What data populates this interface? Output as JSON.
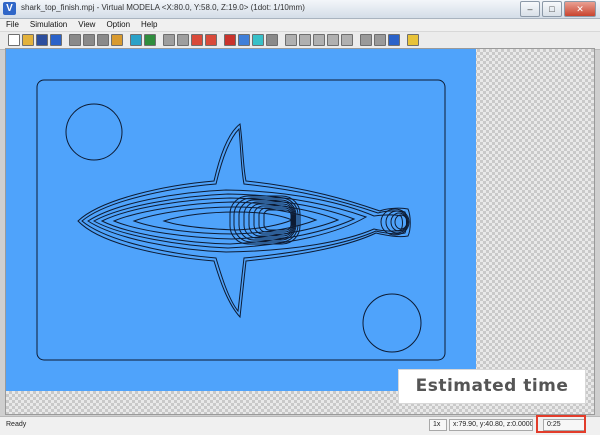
{
  "window": {
    "title": "shark_top_finish.mpj - Virtual MODELA <X:80.0, Y:58.0, Z:19.0> (1dot: 1/10mm)",
    "app_icon_letter": "V",
    "minimize": "–",
    "maximize": "□",
    "close": "✕"
  },
  "menu": {
    "items": [
      "File",
      "Simulation",
      "View",
      "Option",
      "Help"
    ]
  },
  "toolbar": {
    "buttons": [
      {
        "name": "new-file-icon",
        "color": "#ffffff"
      },
      {
        "name": "open-folder-icon",
        "color": "#e3b23c"
      },
      {
        "name": "save-icon",
        "color": "#2d4f9e"
      },
      {
        "name": "restart-icon",
        "color": "#2a62c9"
      },
      {
        "name": "stop-icon",
        "color": "#8a8a8a"
      },
      {
        "name": "play-icon",
        "color": "#8a8a8a"
      },
      {
        "name": "step-icon",
        "color": "#8a8a8a"
      },
      {
        "name": "preview-icon",
        "color": "#d89a2f"
      },
      {
        "name": "view-top-icon",
        "color": "#2aa1c8"
      },
      {
        "name": "view-front-icon",
        "color": "#2f8d3e"
      },
      {
        "name": "tool-path-icon",
        "color": "#9e9e9e"
      },
      {
        "name": "line-icon",
        "color": "#9e9e9e"
      },
      {
        "name": "curve-icon",
        "color": "#d94a3a"
      },
      {
        "name": "3d-view-icon",
        "color": "#d94a3a"
      },
      {
        "name": "red-block-icon",
        "color": "#c9332c"
      },
      {
        "name": "color-block-icon",
        "color": "#3f7fd9"
      },
      {
        "name": "cyan-block-icon",
        "color": "#38c0c8"
      },
      {
        "name": "sphere-icon",
        "color": "#8a8a8a"
      },
      {
        "name": "grid-a-icon",
        "color": "#b0b0b0"
      },
      {
        "name": "grid-b-icon",
        "color": "#b0b0b0"
      },
      {
        "name": "grid-c-icon",
        "color": "#b0b0b0"
      },
      {
        "name": "grid-d-icon",
        "color": "#b0b0b0"
      },
      {
        "name": "target-icon",
        "color": "#b0b0b0"
      },
      {
        "name": "ball-icon",
        "color": "#9a9a9a"
      },
      {
        "name": "gear-icon",
        "color": "#9a9a9a"
      },
      {
        "name": "tool-icon",
        "color": "#2a62c9"
      },
      {
        "name": "star-icon",
        "color": "#e8c33a"
      }
    ]
  },
  "annotation": {
    "label": "Estimated time"
  },
  "status": {
    "ready": "Ready",
    "zoom": "1x",
    "coords": "x:79.90, y:40.80, z:0.0000",
    "time": "0:25"
  },
  "colors": {
    "workpiece_blue": "#4fa3fb",
    "highlight_red": "#e23c2a"
  }
}
